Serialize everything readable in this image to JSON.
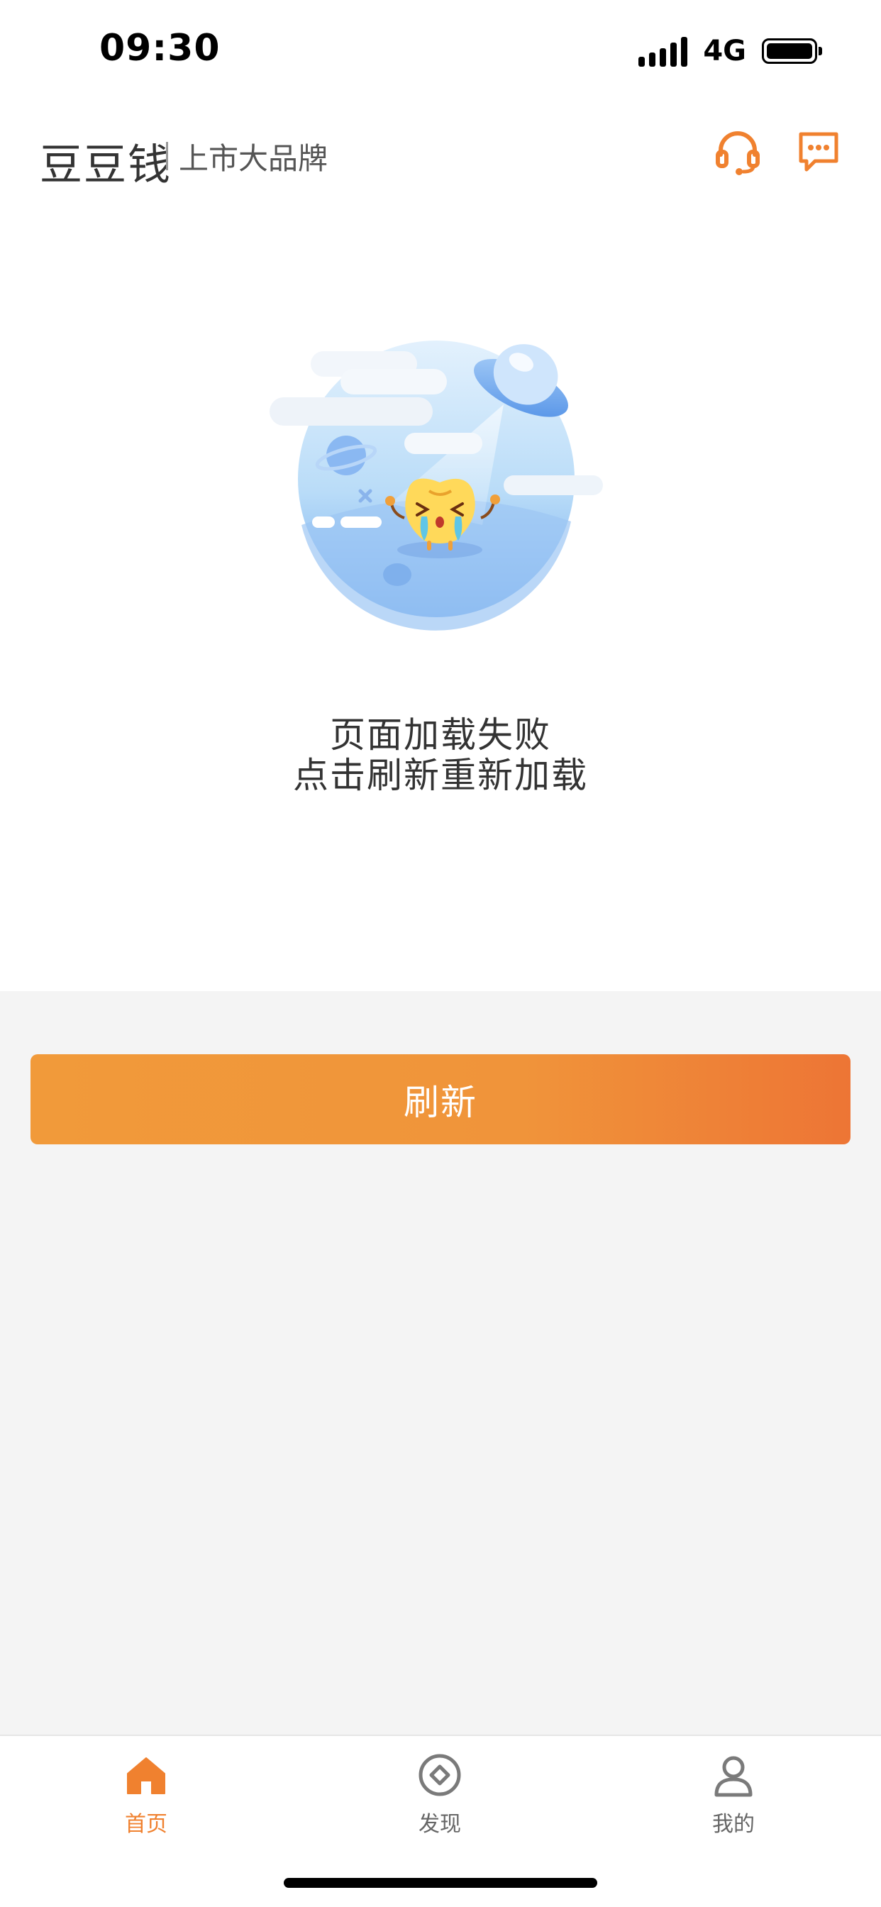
{
  "status_bar": {
    "time": "09:30",
    "network": "4G"
  },
  "header": {
    "brand": "豆豆钱",
    "tagline": "上市大品牌",
    "icons": [
      "headset-icon",
      "message-icon"
    ],
    "accent_color": "#f0812f"
  },
  "error": {
    "illustration": "ufo-crying-mascot-illustration",
    "line1": "页面加载失败",
    "line2": "点击刷新重新加载"
  },
  "refresh_button": {
    "label": "刷新"
  },
  "tabbar": {
    "active_color": "#f0812f",
    "inactive_color": "#666666",
    "tabs": [
      {
        "label": "首页",
        "icon": "home-icon",
        "active": true
      },
      {
        "label": "发现",
        "icon": "discover-icon",
        "active": false
      },
      {
        "label": "我的",
        "icon": "user-icon",
        "active": false
      }
    ]
  }
}
